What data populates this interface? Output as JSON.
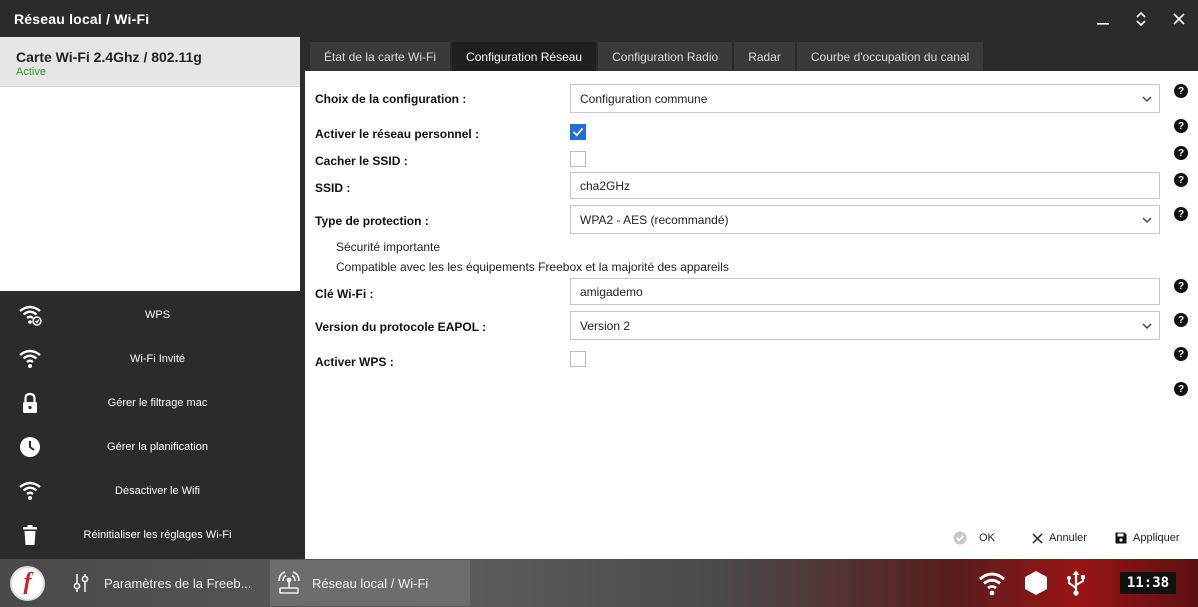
{
  "window": {
    "title": "Réseau local / Wi-Fi",
    "controls": {
      "minimize_icon": "minimize-icon",
      "maximize_icon": "expand-icon",
      "close_icon": "close-icon"
    }
  },
  "sidebar": {
    "card": {
      "name": "Carte Wi-Fi 2.4Ghz / 802.11g",
      "status": "Active"
    },
    "menu": [
      {
        "label": "WPS",
        "icon": "wps-icon"
      },
      {
        "label": "Wi-Fi Invité",
        "icon": "wifi-icon"
      },
      {
        "label": "Gérer le filtrage mac",
        "icon": "lock-icon"
      },
      {
        "label": "Gérer la planification",
        "icon": "clock-icon"
      },
      {
        "label": "Désactiver le Wifi",
        "icon": "wifi-icon"
      },
      {
        "label": "Réinitialiser les réglages Wi-Fi",
        "icon": "trash-icon"
      }
    ]
  },
  "tabs": [
    {
      "label": "État de la carte Wi-Fi",
      "active": false
    },
    {
      "label": "Configuration Réseau",
      "active": true
    },
    {
      "label": "Configuration Radio",
      "active": false
    },
    {
      "label": "Radar",
      "active": false
    },
    {
      "label": "Courbe d'occupation du canal",
      "active": false
    }
  ],
  "form": {
    "config_choice": {
      "label": "Choix de la configuration :",
      "value": "Configuration commune"
    },
    "personal_network": {
      "label": "Activer le réseau personnel :",
      "checked": true
    },
    "hide_ssid": {
      "label": "Cacher le SSID :",
      "checked": false
    },
    "ssid": {
      "label": "SSID :",
      "value": "cha2GHz"
    },
    "protection": {
      "label": "Type de protection :",
      "value": "WPA2 - AES (recommandé)",
      "note1": "Sécurité importante",
      "note2": "Compatible avec les les équipements Freebox et la majorité des appareils"
    },
    "wifi_key": {
      "label": "Clé Wi-Fi :",
      "value": "amigademo"
    },
    "eapol": {
      "label": "Version du protocole EAPOL :",
      "value": "Version 2"
    },
    "wps": {
      "label": "Activer WPS :",
      "checked": false
    },
    "help_glyph": "?"
  },
  "actions": {
    "ok": "OK",
    "cancel": "Annuler",
    "apply": "Appliquer"
  },
  "taskbar": {
    "logo_letter": "f",
    "tasks": [
      {
        "label": "Paramètres de la Freeb...",
        "icon": "settings-sliders-icon",
        "active": false
      },
      {
        "label": "Réseau local / Wi-Fi",
        "icon": "wifi-router-icon",
        "active": true
      }
    ],
    "tray": [
      "wifi-icon",
      "hexagon-icon",
      "usb-icon"
    ],
    "clock": "11:38"
  },
  "colors": {
    "accent_blue": "#1e6fd9",
    "status_green": "#2e9e2e",
    "dark_bg": "#2b2b2b",
    "taskbar_red": "#9a1414"
  }
}
